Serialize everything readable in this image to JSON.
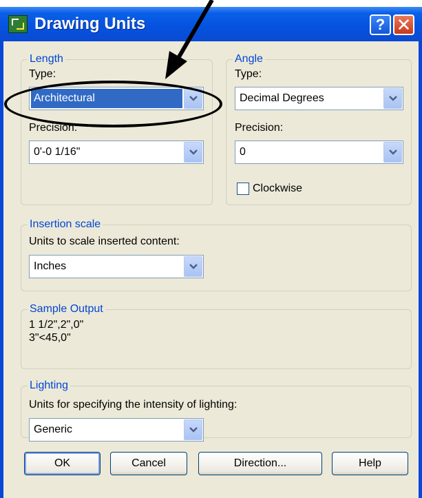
{
  "window": {
    "title": "Drawing Units",
    "help_label": "?",
    "close_label": "✕"
  },
  "length": {
    "legend": "Length",
    "type_label": "Type:",
    "type_value": "Architectural",
    "precision_label": "Precision:",
    "precision_value": "0'-0 1/16\""
  },
  "angle": {
    "legend": "Angle",
    "type_label": "Type:",
    "type_value": "Decimal Degrees",
    "precision_label": "Precision:",
    "precision_value": "0",
    "clockwise_label": "Clockwise",
    "clockwise_checked": false
  },
  "insertion": {
    "legend": "Insertion scale",
    "units_label": "Units to scale inserted content:",
    "units_value": "Inches"
  },
  "sample": {
    "legend": "Sample Output",
    "line1": "1 1/2\",2\",0\"",
    "line2": "3\"<45,0\""
  },
  "lighting": {
    "legend": "Lighting",
    "units_label": "Units for specifying the intensity of lighting:",
    "units_value": "Generic"
  },
  "buttons": {
    "ok": "OK",
    "cancel": "Cancel",
    "direction": "Direction...",
    "help": "Help"
  },
  "icons": {
    "title_icon": "drawing-units-app-icon",
    "dropdown": "chevron-down-icon"
  },
  "colors": {
    "titlebar": "#0553e0",
    "dialog_bg": "#ece9d8",
    "group_legend": "#0046d5",
    "selection": "#316ac5",
    "annotation": "#000000"
  }
}
